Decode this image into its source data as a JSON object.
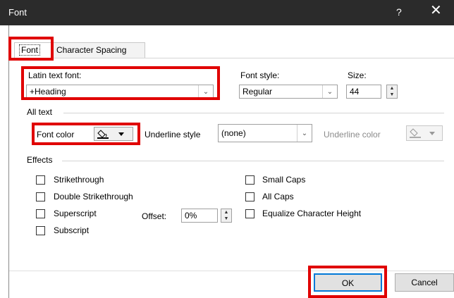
{
  "window": {
    "title": "Font",
    "help_label": "?",
    "close_label": "✕"
  },
  "tabs": [
    {
      "label": "Font",
      "active": true
    },
    {
      "label": "Character Spacing",
      "active": false
    }
  ],
  "latin_font": {
    "label": "Latin text font:",
    "value": "+Heading"
  },
  "font_style": {
    "label": "Font style:",
    "value": "Regular"
  },
  "size": {
    "label": "Size:",
    "value": "44"
  },
  "all_text": {
    "section_label": "All text",
    "font_color_label": "Font color",
    "underline_style_label": "Underline style",
    "underline_style_value": "(none)",
    "underline_color_label": "Underline color"
  },
  "effects": {
    "section_label": "Effects",
    "left": [
      {
        "label": "Strikethrough",
        "checked": false
      },
      {
        "label": "Double Strikethrough",
        "checked": false
      },
      {
        "label": "Superscript",
        "checked": false
      },
      {
        "label": "Subscript",
        "checked": false
      }
    ],
    "offset_label": "Offset:",
    "offset_value": "0%",
    "right": [
      {
        "label": "Small Caps",
        "checked": false
      },
      {
        "label": "All Caps",
        "checked": false
      },
      {
        "label": "Equalize Character Height",
        "checked": false
      }
    ]
  },
  "buttons": {
    "ok": "OK",
    "cancel": "Cancel"
  },
  "colors": {
    "highlight": "#e00000",
    "titlebar": "#2b2b2b",
    "ok_border": "#0078d7"
  }
}
